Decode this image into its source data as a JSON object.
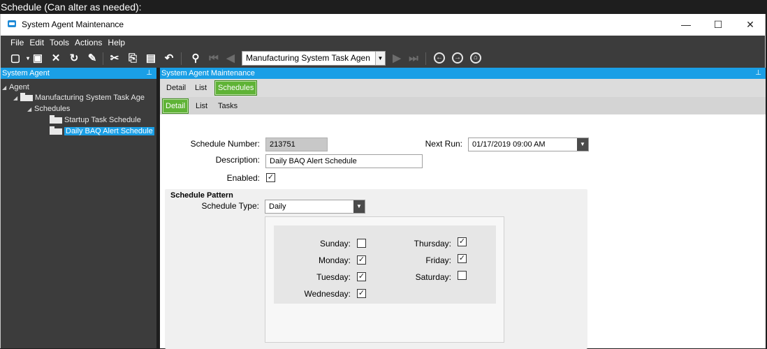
{
  "outer_caption": "Schedule (Can alter as needed):",
  "window": {
    "title": "System Agent Maintenance",
    "minimize": "—",
    "maximize": "☐",
    "close": "✕"
  },
  "menu": [
    "File",
    "Edit",
    "Tools",
    "Actions",
    "Help"
  ],
  "toolbar": {
    "combo_value": "Manufacturing System Task Agen",
    "icons": [
      "new-icon",
      "save-icon",
      "delete-icon",
      "refresh-icon",
      "clear-icon",
      "cut-icon",
      "copy-icon",
      "paste-icon",
      "undo-icon",
      "search-icon",
      "first-record-icon",
      "prev-record-icon",
      "next-record-icon",
      "last-record-icon",
      "back-icon",
      "forward-icon",
      "home-icon"
    ]
  },
  "left_pane": {
    "header": "System Agent",
    "pin": "⊥",
    "tree": [
      {
        "label": "Agent",
        "level": 0
      },
      {
        "label": "Manufacturing System Task Age",
        "level": 1
      },
      {
        "label": "Schedules",
        "level": 2
      },
      {
        "label": "Startup Task Schedule",
        "level": 3
      },
      {
        "label": "Daily BAQ Alert Schedule",
        "level": 3,
        "selected": true
      }
    ]
  },
  "right_pane": {
    "header": "System Agent Maintenance",
    "pin": "⊥",
    "tabs_top": [
      "Detail",
      "List",
      "Schedules"
    ],
    "tabs_top_active": "Schedules",
    "tabs_sub": [
      "Detail",
      "List",
      "Tasks"
    ],
    "tabs_sub_active": "Detail"
  },
  "form": {
    "schedule_number_label": "Schedule Number:",
    "schedule_number": "213751",
    "next_run_label": "Next Run:",
    "next_run": "01/17/2019 09:00 AM",
    "description_label": "Description:",
    "description": "Daily BAQ Alert Schedule",
    "enabled_label": "Enabled:",
    "enabled": true,
    "pattern_title": "Schedule Pattern",
    "schedule_type_label": "Schedule Type:",
    "schedule_type": "Daily",
    "days": {
      "sunday": {
        "label": "Sunday:",
        "checked": false
      },
      "monday": {
        "label": "Monday:",
        "checked": true
      },
      "tuesday": {
        "label": "Tuesday:",
        "checked": true
      },
      "wednesday": {
        "label": "Wednesday:",
        "checked": true
      },
      "thursday": {
        "label": "Thursday:",
        "checked": true
      },
      "friday": {
        "label": "Friday:",
        "checked": true
      },
      "saturday": {
        "label": "Saturday:",
        "checked": false
      }
    }
  },
  "colors": {
    "accent_blue": "#1a9fe6",
    "tab_green": "#5fb336",
    "dark_chrome": "#3c3c3c"
  }
}
